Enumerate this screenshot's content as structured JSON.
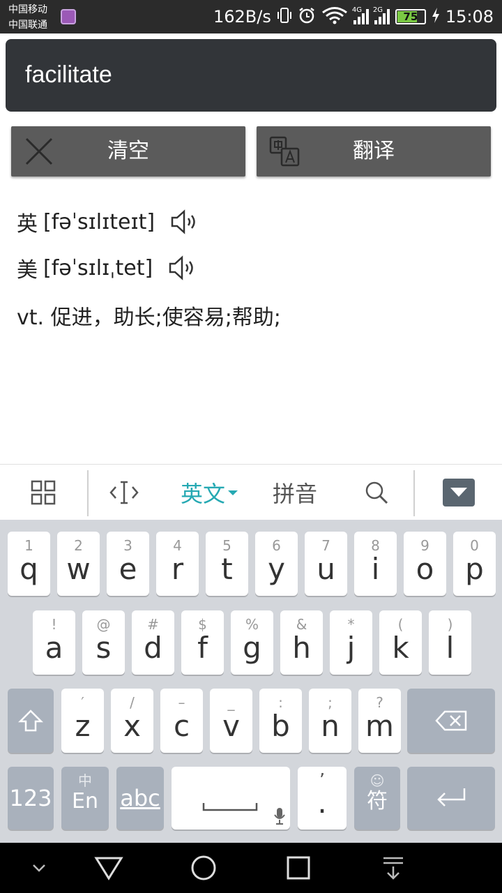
{
  "status_bar": {
    "carrier1": "中国移动",
    "carrier2": "中国联通",
    "net_speed": "162B/s",
    "network1": "4G",
    "network2": "2G",
    "battery": "75",
    "battery_level_percent": 75,
    "time": "15:08"
  },
  "input": {
    "value": "facilitate"
  },
  "buttons": {
    "clear": "清空",
    "translate": "翻译"
  },
  "result": {
    "uk_label": "英",
    "uk_phonetic": "[fəˈsɪlɪteɪt]",
    "us_label": "美",
    "us_phonetic": "[fəˈsɪlɪˌtet]",
    "definition": "vt. 促进，助长;使容易;帮助;"
  },
  "keyboard_toolbar": {
    "lang_english": "英文",
    "lang_pinyin": "拼音",
    "icons": [
      "grid-icon",
      "cursor-icon",
      "search-icon",
      "hide-keyboard-icon"
    ]
  },
  "keyboard": {
    "row1": [
      {
        "hint": "1",
        "key": "q"
      },
      {
        "hint": "2",
        "key": "w"
      },
      {
        "hint": "3",
        "key": "e"
      },
      {
        "hint": "4",
        "key": "r"
      },
      {
        "hint": "5",
        "key": "t"
      },
      {
        "hint": "6",
        "key": "y"
      },
      {
        "hint": "7",
        "key": "u"
      },
      {
        "hint": "8",
        "key": "i"
      },
      {
        "hint": "9",
        "key": "o"
      },
      {
        "hint": "0",
        "key": "p"
      }
    ],
    "row2": [
      {
        "hint": "!",
        "key": "a"
      },
      {
        "hint": "@",
        "key": "s"
      },
      {
        "hint": "#",
        "key": "d"
      },
      {
        "hint": "$",
        "key": "f"
      },
      {
        "hint": "%",
        "key": "g"
      },
      {
        "hint": "&",
        "key": "h"
      },
      {
        "hint": "*",
        "key": "j"
      },
      {
        "hint": "(",
        "key": "k"
      },
      {
        "hint": ")",
        "key": "l"
      }
    ],
    "row3": [
      {
        "hint": "′",
        "key": "z"
      },
      {
        "hint": "/",
        "key": "x"
      },
      {
        "hint": "–",
        "key": "c"
      },
      {
        "hint": "_",
        "key": "v"
      },
      {
        "hint": ":",
        "key": "b"
      },
      {
        "hint": ";",
        "key": "n"
      },
      {
        "hint": "?",
        "key": "m"
      }
    ],
    "num_key": "123",
    "lang_key_hint": "中",
    "lang_key": "En",
    "abc_key": "abc",
    "period_hint": "’",
    "period_key": ".",
    "symbol_key": "符"
  },
  "colors": {
    "accent": "#26a9b3",
    "battery": "#7ac943",
    "input_bg": "#323539",
    "button_bg": "#5b5b5b"
  }
}
